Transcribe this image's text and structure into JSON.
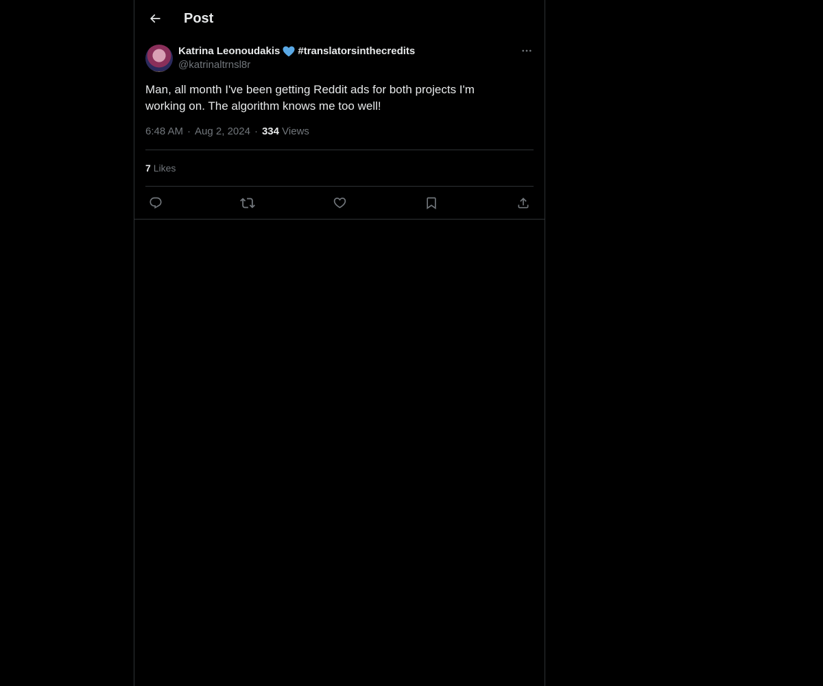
{
  "header": {
    "title": "Post",
    "back_icon": "arrow-left-icon"
  },
  "post": {
    "author_name": "Katrina Leonoudakis",
    "author_emoji": "blue-heart-icon",
    "author_hashtag": "#translatorsinthecredits",
    "handle": "@katrinaltrnsl8r",
    "text": "Man, all month I've been getting Reddit ads for both projects I'm working on. The algorithm knows me too well!",
    "time": "6:48 AM",
    "date": "Aug 2, 2024",
    "views_count": "334",
    "views_label": "Views",
    "likes_count": "7",
    "likes_label": "Likes"
  },
  "actions": [
    {
      "name": "reply",
      "icon": "reply-icon"
    },
    {
      "name": "repost",
      "icon": "repost-icon"
    },
    {
      "name": "like",
      "icon": "heart-icon"
    },
    {
      "name": "bookmark",
      "icon": "bookmark-icon"
    },
    {
      "name": "share",
      "icon": "share-icon"
    }
  ],
  "colors": {
    "background": "#000000",
    "text": "#e7e9ea",
    "secondary": "#71767b",
    "border": "#2f3336",
    "emoji": "#5aa9e6"
  }
}
